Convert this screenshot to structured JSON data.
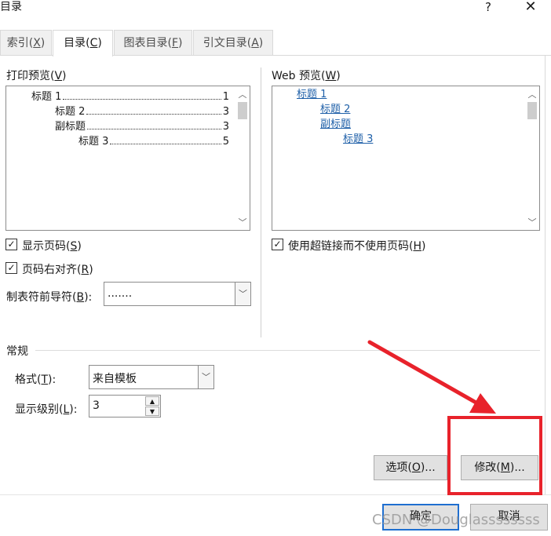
{
  "window": {
    "title": "目录",
    "help_label": "?",
    "close_label": "✕"
  },
  "tabs": [
    {
      "label_pre": "索引(",
      "key": "X",
      "label_post": ")"
    },
    {
      "label_pre": "目录(",
      "key": "C",
      "label_post": ")"
    },
    {
      "label_pre": "图表目录(",
      "key": "F",
      "label_post": ")"
    },
    {
      "label_pre": "引文目录(",
      "key": "A",
      "label_post": ")"
    }
  ],
  "print_preview": {
    "label_pre": "打印预览(",
    "key": "V",
    "label_post": ")",
    "entries": [
      {
        "text": "标题 1",
        "page": "1"
      },
      {
        "text": "标题 2",
        "page": "3"
      },
      {
        "text": "副标题",
        "page": "3"
      },
      {
        "text": "标题 3",
        "page": "5"
      }
    ]
  },
  "web_preview": {
    "label_pre": "Web 预览(",
    "key": "W",
    "label_post": ")",
    "entries": [
      "标题 1",
      "标题 2",
      "副标题",
      "标题 3"
    ]
  },
  "options": {
    "show_page_numbers": {
      "pre": "显示页码(",
      "key": "S",
      "post": ")",
      "checked": true
    },
    "right_align": {
      "pre": "页码右对齐(",
      "key": "R",
      "post": ")",
      "checked": true
    },
    "use_hyperlinks": {
      "pre": "使用超链接而不使用页码(",
      "key": "H",
      "post": ")",
      "checked": true
    },
    "tab_leader": {
      "pre": "制表符前导符(",
      "key": "B",
      "post": "):",
      "value": "......."
    }
  },
  "general": {
    "heading": "常规",
    "format": {
      "pre": "格式(",
      "key": "T",
      "post": "):",
      "value": "来自模板"
    },
    "levels": {
      "pre": "显示级别(",
      "key": "L",
      "post": "):",
      "value": "3"
    }
  },
  "buttons": {
    "options": {
      "pre": "选项(",
      "key": "O",
      "post": ")..."
    },
    "modify": {
      "pre": "修改(",
      "key": "M",
      "post": ")..."
    },
    "ok": "确定",
    "cancel": "取消"
  },
  "watermark": "CSDN @Douglassssssss",
  "colors": {
    "accent": "#1f6fd0",
    "link": "#1e5fa8",
    "annotation": "#e8222b"
  }
}
